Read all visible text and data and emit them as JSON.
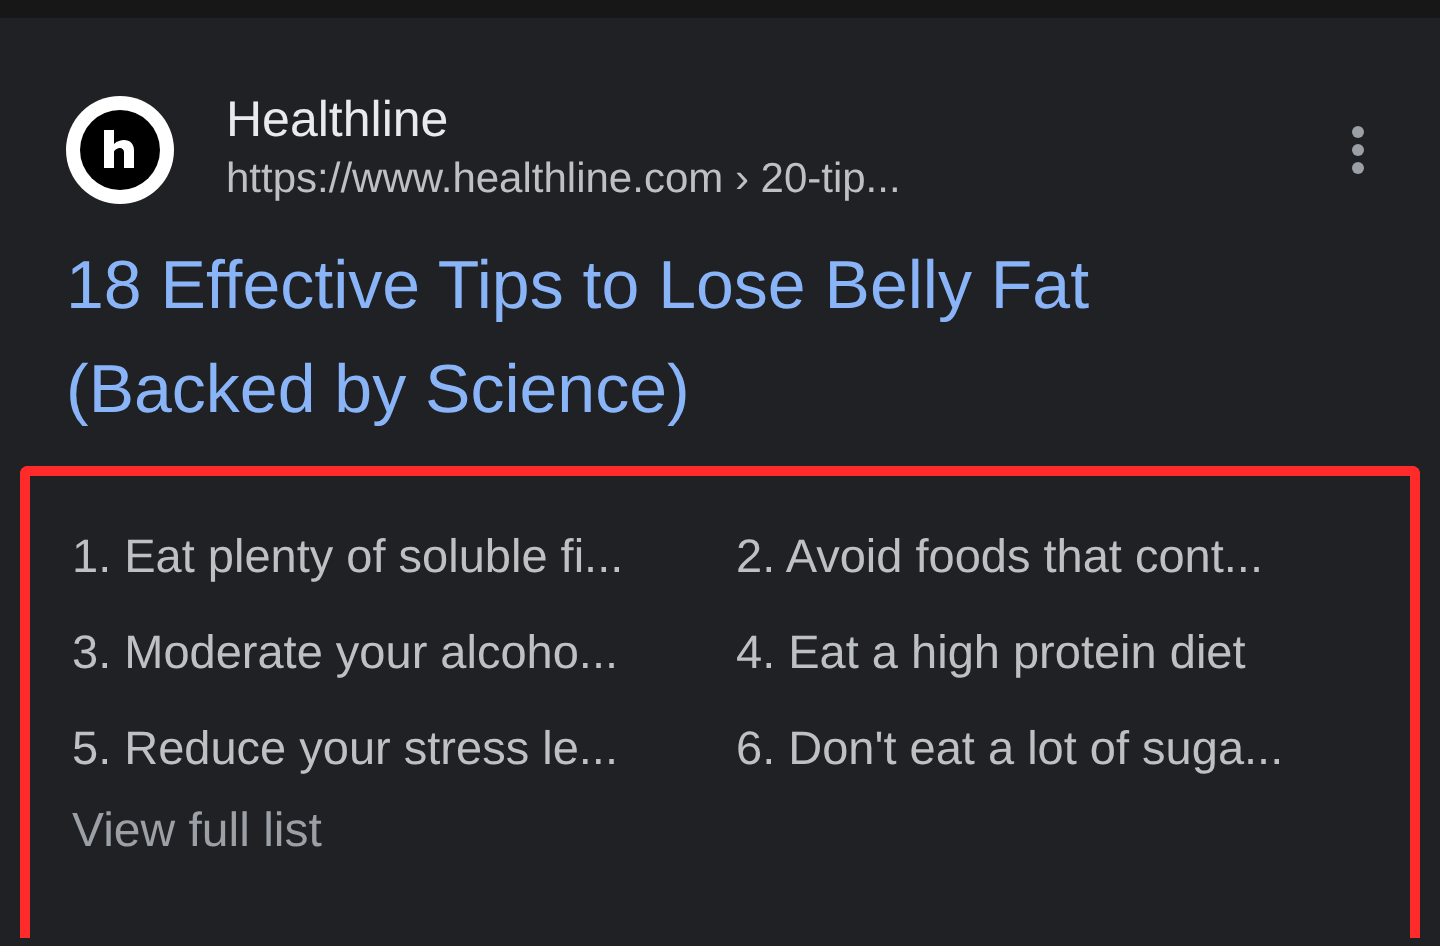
{
  "result": {
    "site_name": "Healthline",
    "url": "https://www.healthline.com › 20-tip...",
    "title": "18 Effective Tips to Lose Belly Fat (Backed by Science)"
  },
  "list": {
    "highlighted": true,
    "items": [
      {
        "text": "1. Eat plenty of soluble fi..."
      },
      {
        "text": "2. Avoid foods that cont..."
      },
      {
        "text": "3. Moderate your alcoho..."
      },
      {
        "text": "4. Eat a high protein diet"
      },
      {
        "text": "5. Reduce your stress le..."
      },
      {
        "text": "6. Don't eat a lot of suga..."
      }
    ],
    "more_link": "View full list"
  }
}
